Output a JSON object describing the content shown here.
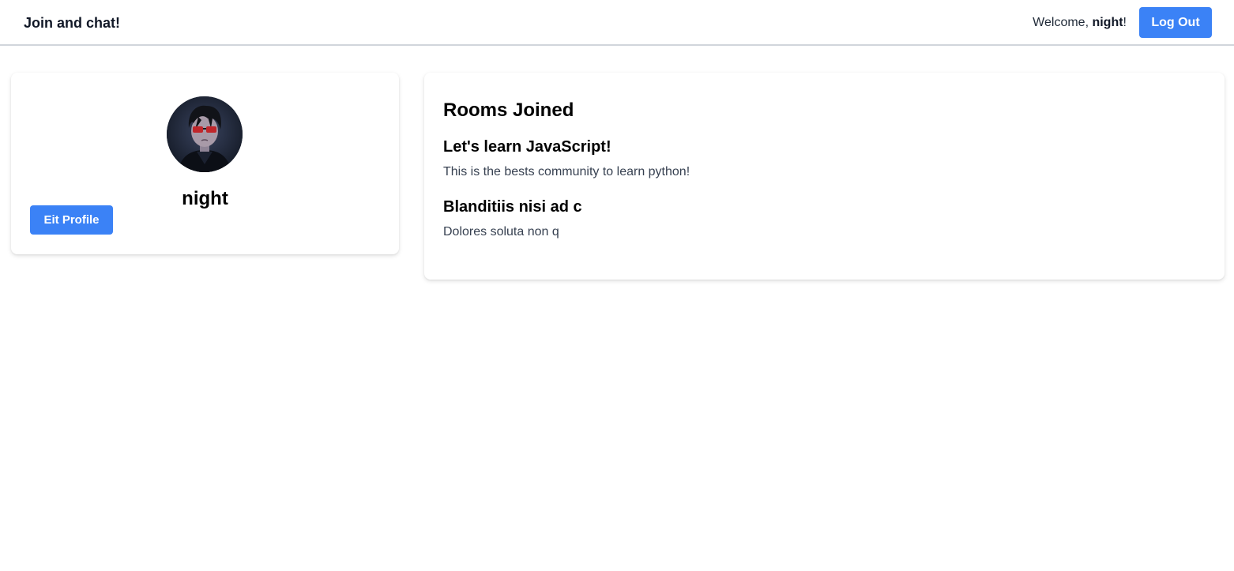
{
  "header": {
    "brand": "Join and chat!",
    "welcome_prefix": "Welcome, ",
    "username": "night",
    "welcome_suffix": "!",
    "logout_label": "Log Out"
  },
  "profile": {
    "name": "night",
    "edit_label": "Eit Profile"
  },
  "rooms": {
    "title": "Rooms Joined",
    "items": [
      {
        "name": "Let's learn JavaScript!",
        "description": "This is the bests community to learn python!"
      },
      {
        "name": "Blanditiis nisi ad c",
        "description": "Dolores soluta non q"
      }
    ]
  },
  "colors": {
    "accent": "#3b82f6",
    "divider": "#d1d5db"
  }
}
